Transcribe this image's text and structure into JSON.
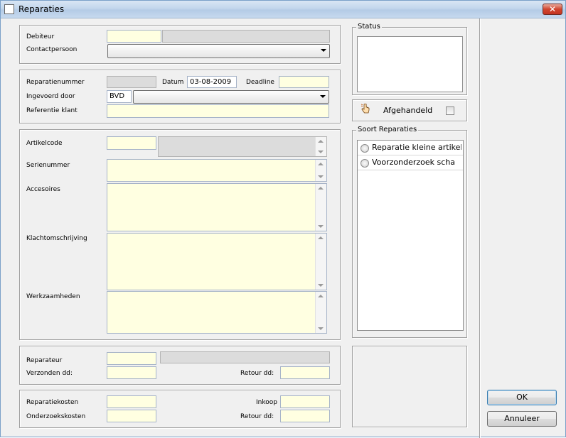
{
  "window": {
    "title": "Reparaties",
    "close_label": "✕"
  },
  "debiteur_section": {
    "debiteur_label": "Debiteur",
    "debiteur_value": "",
    "debiteur_name": "",
    "contact_label": "Contactpersoon",
    "contact_value": ""
  },
  "reparatie_section": {
    "nummer_label": "Reparatienummer",
    "nummer_value": "",
    "datum_label": "Datum",
    "datum_value": "03-08-2009",
    "deadline_label": "Deadline",
    "deadline_value": "",
    "ingevoerd_label": "Ingevoerd door",
    "ingevoerd_code": "BVD",
    "ingevoerd_name": "",
    "referentie_label": "Referentie klant",
    "referentie_value": ""
  },
  "artikel_section": {
    "artikelcode_label": "Artikelcode",
    "artikelcode_value": "",
    "serienummer_label": "Serienummer",
    "serienummer_value": "",
    "accesoires_label": "Accesoires",
    "accesoires_value": "",
    "klacht_label": "Klachtomschrijving",
    "klacht_value": "",
    "werk_label": "Werkzaamheden",
    "werk_value": ""
  },
  "reparateur_section": {
    "reparateur_label": "Reparateur",
    "reparateur_value": "",
    "verzonden_label": "Verzonden dd:",
    "verzonden_value": "",
    "retour_label": "Retour dd:",
    "retour_value": ""
  },
  "kosten_section": {
    "reparatiekosten_label": "Reparatiekosten",
    "reparatiekosten_value": "",
    "onderzoekskosten_label": "Onderzoekskosten",
    "onderzoekskosten_value": "",
    "inkoop_label": "Inkoop",
    "inkoop_value": "",
    "retour_label": "Retour dd:",
    "retour_value": ""
  },
  "status_group": {
    "legend": "Status"
  },
  "afgehandeld": {
    "label": "Afgehandeld",
    "checked": false
  },
  "soort_group": {
    "legend": "Soort Reparaties",
    "options": [
      {
        "label": "Reparatie kleine artikel",
        "selected": false
      },
      {
        "label": "Voorzonderzoek scha",
        "selected": false
      }
    ]
  },
  "buttons": {
    "ok": "OK",
    "annuleer": "Annuleer"
  }
}
